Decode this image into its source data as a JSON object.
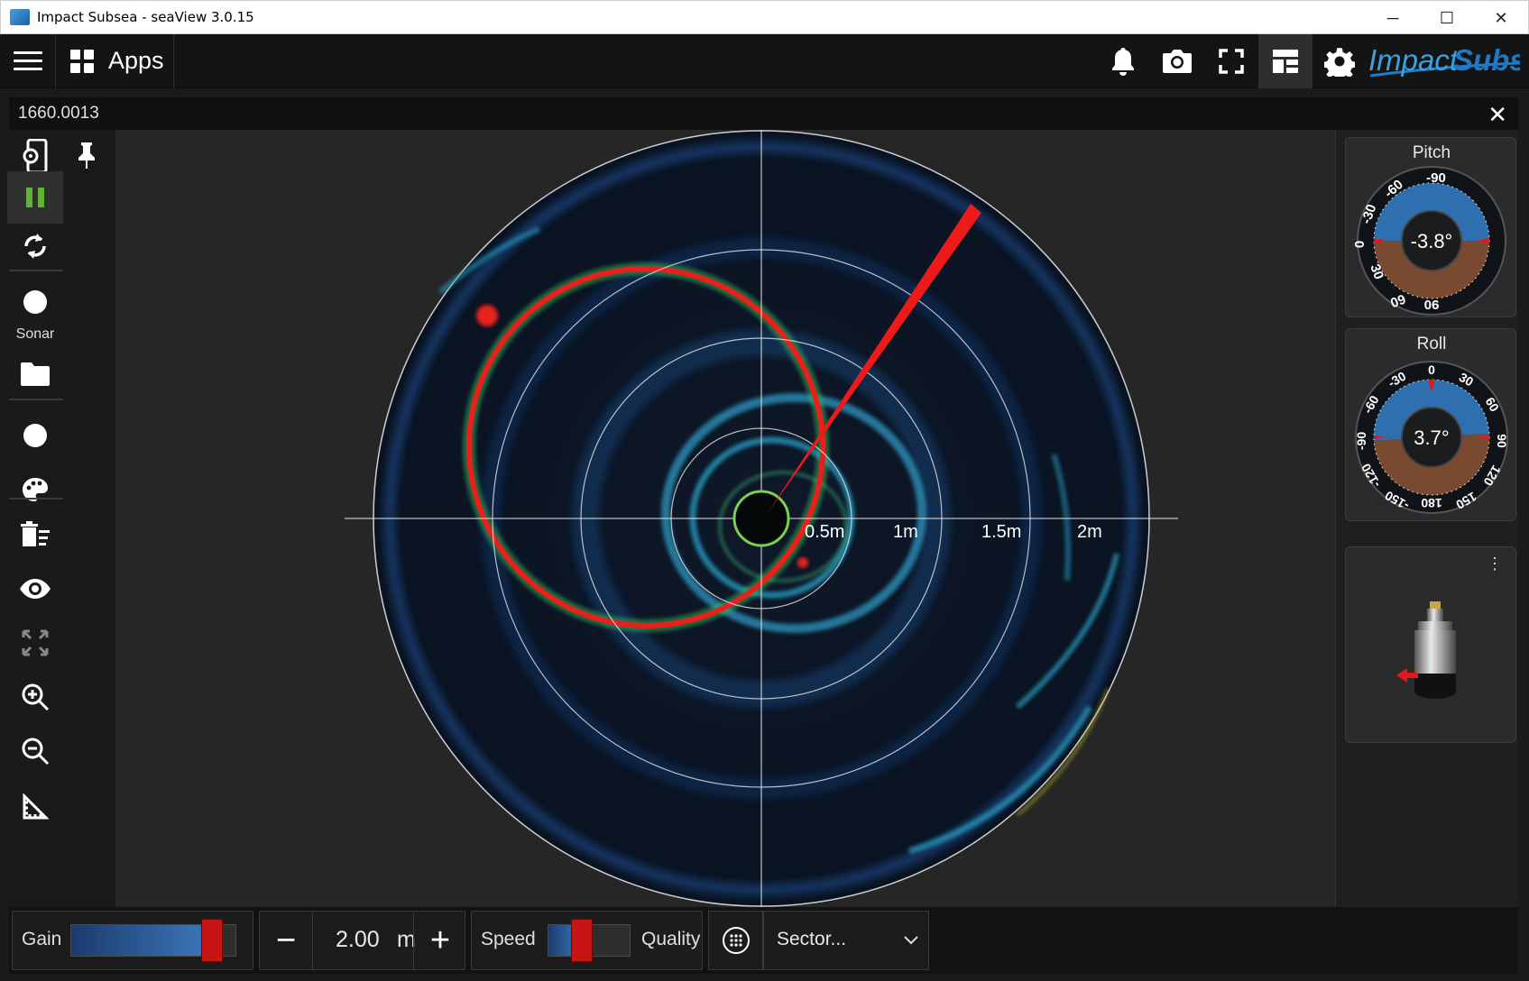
{
  "window": {
    "title": "Impact Subsea - seaView 3.0.15",
    "controls": [
      "minimize",
      "maximize",
      "close"
    ]
  },
  "topbar": {
    "apps_label": "Apps",
    "icons": [
      "bell-icon",
      "camera-icon",
      "fullscreen-icon",
      "layout-icon",
      "gear-icon"
    ],
    "logo_text": "ImpactSubsea"
  },
  "panel": {
    "device_id": "1660.0013"
  },
  "sidebar": {
    "sonar_label": "Sonar",
    "items": [
      "device-settings",
      "pause",
      "refresh",
      "record",
      "folder",
      "record-secondary",
      "color-palette",
      "clear",
      "view",
      "fit",
      "zoom-in",
      "zoom-out",
      "measure"
    ]
  },
  "sonar": {
    "range_labels": [
      "0.5m",
      "1m",
      "1.5m",
      "2m"
    ],
    "rings": 4,
    "heading_line_angle_deg": 33,
    "colors": {
      "background": "#0a1220",
      "ring": "#dddddd",
      "echo_strong": "#e8201a",
      "echo_mid": "#2aa3c9",
      "heading": "#ee1a1a"
    }
  },
  "instruments": {
    "pitch": {
      "title": "Pitch",
      "value": "-3.8°",
      "scale": [
        "-90",
        "-60",
        "-30",
        "0",
        "30",
        "60",
        "90"
      ]
    },
    "roll": {
      "title": "Roll",
      "value": "3.7°",
      "scale": [
        "0",
        "30",
        "60",
        "90",
        "120",
        "150",
        "180",
        "-150",
        "-120",
        "-90",
        "-60",
        "-30"
      ]
    },
    "sensor_more": "⋮"
  },
  "bottom": {
    "gain_label": "Gain",
    "gain_level": 0.84,
    "range_value": "2.00",
    "range_unit": "m",
    "minus": "−",
    "plus": "+",
    "speed_label": "Speed",
    "quality_label": "Quality",
    "speed_quality_level": 0.4,
    "mode_value": "Sector..."
  }
}
